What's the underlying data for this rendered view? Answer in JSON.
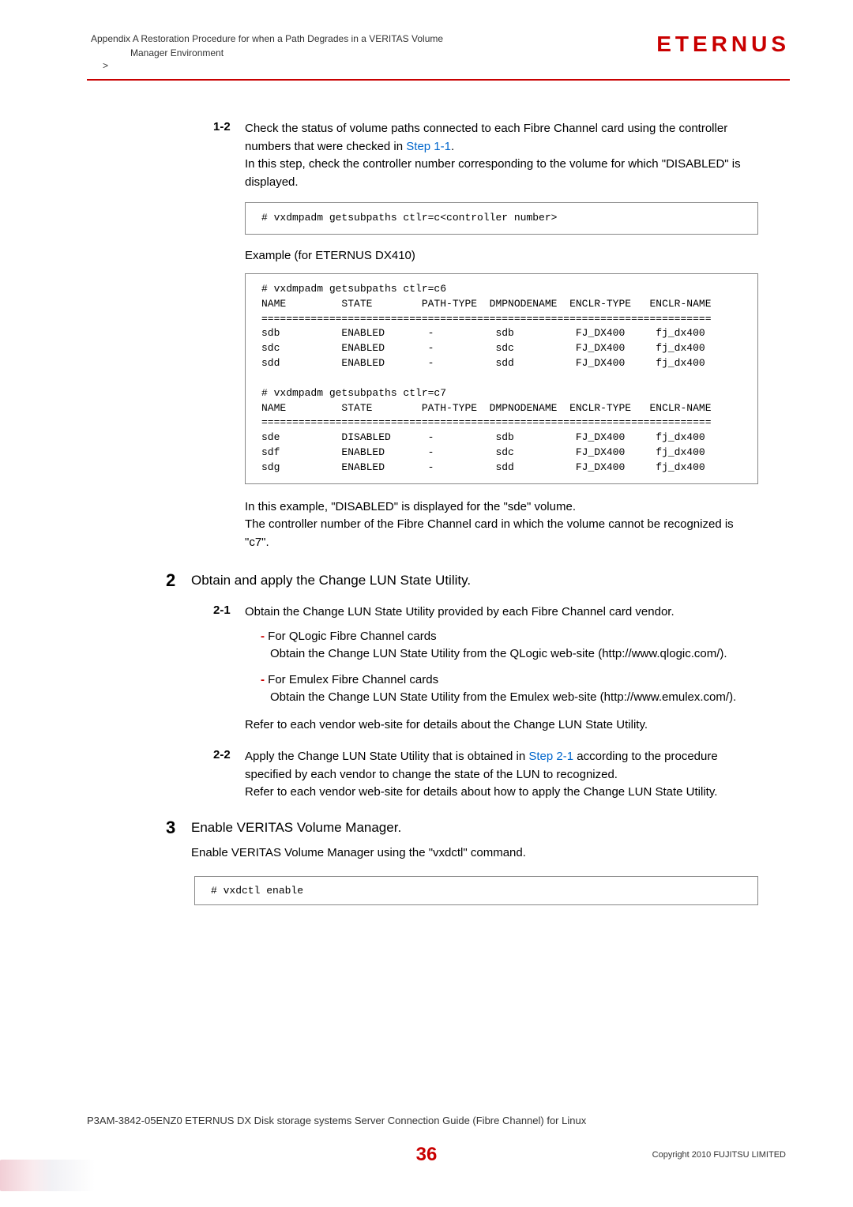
{
  "header": {
    "appendix": "Appendix A  Restoration Procedure for when a Path Degrades in a VERITAS Volume",
    "subtitle": "Manager Environment",
    "gt": " >",
    "logo": "ETERNUS"
  },
  "step12": {
    "num": "1-2",
    "l1": "Check the status of volume paths connected to each Fibre Channel card using the controller numbers that were checked in ",
    "l1link": "Step 1-1",
    "l1end": ".",
    "l2": "In this step, check the controller number corresponding to the volume for which \"DISABLED\" is displayed."
  },
  "code1": "# vxdmpadm getsubpaths ctlr=c<controller number>",
  "example_label": "Example (for ETERNUS DX410)",
  "code2": "# vxdmpadm getsubpaths ctlr=c6\nNAME         STATE        PATH-TYPE  DMPNODENAME  ENCLR-TYPE   ENCLR-NAME\n=========================================================================\nsdb          ENABLED       -          sdb          FJ_DX400     fj_dx400\nsdc          ENABLED       -          sdc          FJ_DX400     fj_dx400\nsdd          ENABLED       -          sdd          FJ_DX400     fj_dx400\n\n# vxdmpadm getsubpaths ctlr=c7\nNAME         STATE        PATH-TYPE  DMPNODENAME  ENCLR-TYPE   ENCLR-NAME\n=========================================================================\nsde          DISABLED      -          sdb          FJ_DX400     fj_dx400\nsdf          ENABLED       -          sdc          FJ_DX400     fj_dx400\nsdg          ENABLED       -          sdd          FJ_DX400     fj_dx400",
  "after_example": "In this example, \"DISABLED\" is displayed for the \"sde\" volume.\nThe controller number of the Fibre Channel card in which the volume cannot be recognized is \"c7\".",
  "main2": {
    "num": "2",
    "text": "Obtain and apply the Change LUN State Utility."
  },
  "step21": {
    "num": "2-1",
    "text": "Obtain the Change LUN State Utility provided by each Fibre Channel card vendor.",
    "b1_title": "For QLogic Fibre Channel cards",
    "b1_body": "Obtain the Change LUN State Utility from the QLogic web-site (http://www.qlogic.com/).",
    "b2_title": "For Emulex Fibre Channel cards",
    "b2_body": "Obtain the Change LUN State Utility from the Emulex web-site (http://www.emulex.com/).",
    "after": "Refer to each vendor web-site for details about the Change LUN State Utility."
  },
  "step22": {
    "num": "2-2",
    "l1a": "Apply the Change LUN State Utility that is obtained in ",
    "l1link": "Step 2-1",
    "l1b": " according to the procedure specified by each vendor to change the state of the LUN to recognized.",
    "l2": "Refer to each vendor web-site for details about how to apply the Change LUN State Utility."
  },
  "main3": {
    "num": "3",
    "text": "Enable VERITAS Volume Manager.",
    "body": "Enable VERITAS Volume Manager using the \"vxdctl\" command."
  },
  "code3": "# vxdctl enable",
  "footer": {
    "doc": "P3AM-3842-05ENZ0  ETERNUS DX Disk storage systems Server Connection Guide (Fibre Channel) for Linux",
    "page": "36",
    "copyright": "Copyright 2010 FUJITSU LIMITED"
  }
}
